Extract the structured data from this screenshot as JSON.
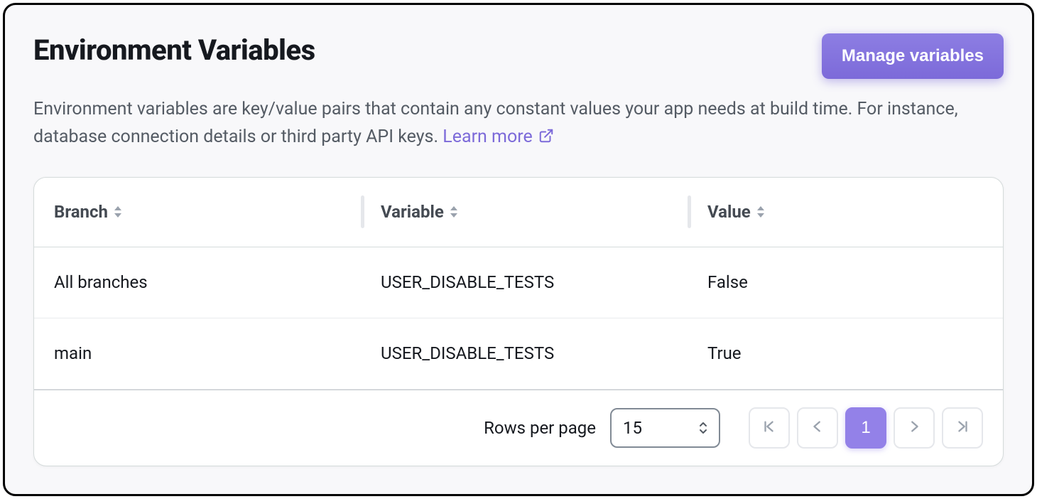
{
  "header": {
    "title": "Environment Variables",
    "manage_button": "Manage variables"
  },
  "description": {
    "text_part1": "Environment variables are key/value pairs that contain any constant values your app needs at build time. For instance, database connection details or third party API keys. ",
    "learn_more": "Learn more"
  },
  "table": {
    "columns": {
      "branch": "Branch",
      "variable": "Variable",
      "value": "Value"
    },
    "rows": [
      {
        "branch": "All branches",
        "variable": "USER_DISABLE_TESTS",
        "value": "False"
      },
      {
        "branch": "main",
        "variable": "USER_DISABLE_TESTS",
        "value": "True"
      }
    ]
  },
  "pagination": {
    "rows_per_page_label": "Rows per page",
    "rows_per_page_value": "15",
    "current_page": "1"
  }
}
